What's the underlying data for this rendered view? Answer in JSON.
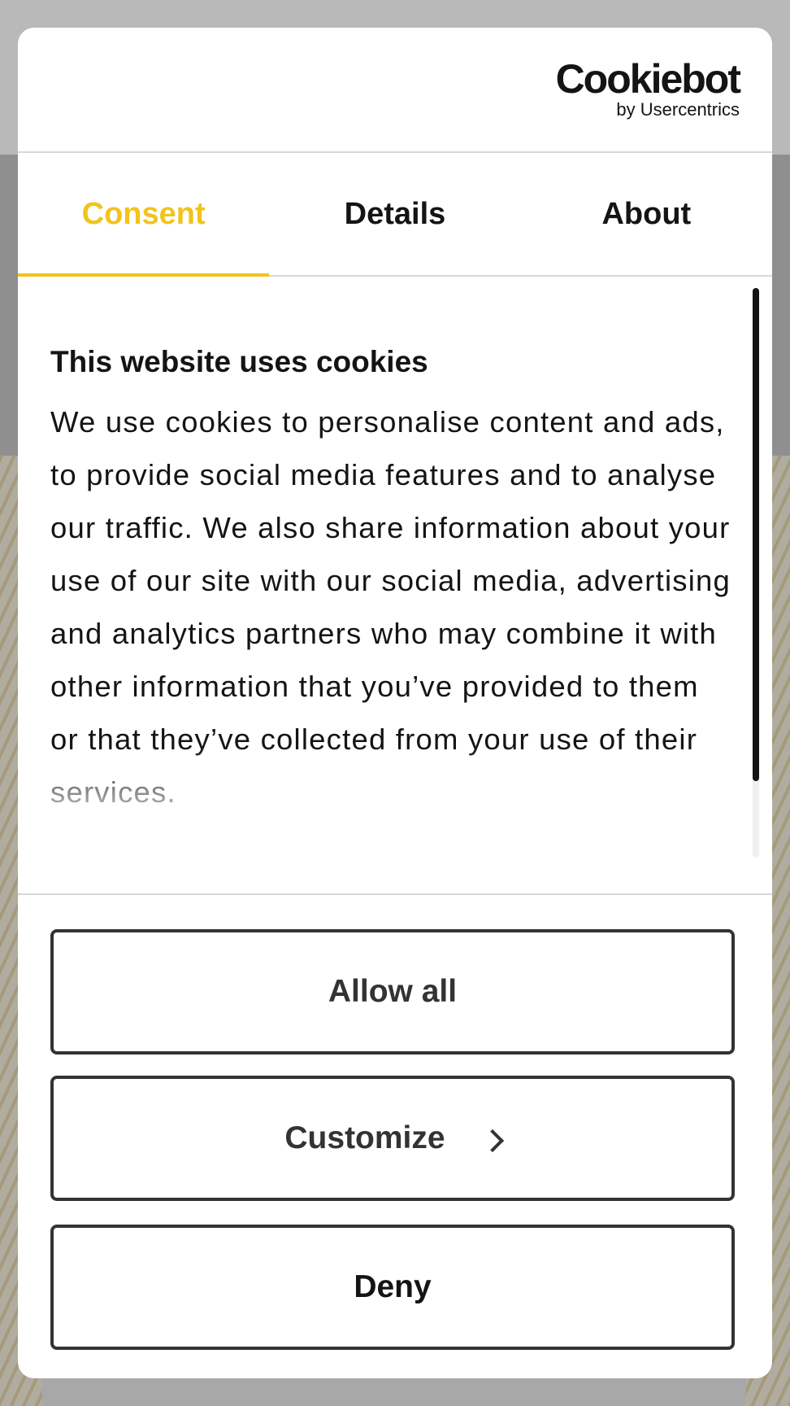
{
  "logo": {
    "name": "Cookiebot",
    "subtitle": "by Usercentrics"
  },
  "tabs": [
    {
      "label": "Consent",
      "active": true
    },
    {
      "label": "Details",
      "active": false
    },
    {
      "label": "About",
      "active": false
    }
  ],
  "content": {
    "title": "This website uses cookies",
    "body": "We use cookies to personalise content and ads, to provide social media features and to analyse our traffic. We also share information about your use of our site with our social media, advertising and analytics partners who may combine it with other information that you’ve provided to them or that they’ve collected from your use of their services."
  },
  "buttons": {
    "allow_all": "Allow all",
    "customize": "Customize",
    "deny": "Deny"
  },
  "icons": {
    "customize_arrow": "chevron-right-icon"
  },
  "colors": {
    "accent": "#f2c31b",
    "text": "#141414",
    "button_border": "#333333"
  }
}
